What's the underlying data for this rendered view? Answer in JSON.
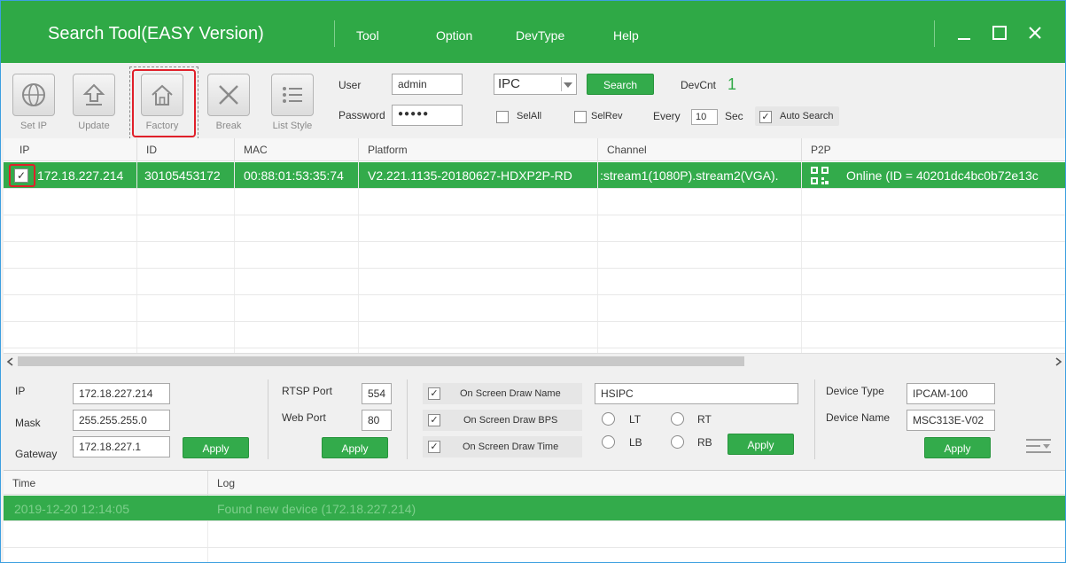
{
  "app": {
    "title": "Search Tool(EASY Version)",
    "menu": [
      "Tool",
      "Option",
      "DevType",
      "Help"
    ]
  },
  "toolbar": {
    "buttons": [
      {
        "label": "Set IP",
        "icon": "globe-icon"
      },
      {
        "label": "Update",
        "icon": "upload-arrow-icon"
      },
      {
        "label": "Factory",
        "icon": "home-icon"
      },
      {
        "label": "Break",
        "icon": "close-x-icon"
      },
      {
        "label": "List Style",
        "icon": "list-icon"
      }
    ],
    "user_label": "User",
    "user_value": "admin",
    "password_label": "Password",
    "password_value": "●●●●●",
    "devtype_value": "IPC",
    "search_label": "Search",
    "devcnt_label": "DevCnt",
    "devcnt_value": "1",
    "selall_label": "SelAll",
    "selrev_label": "SelRev",
    "every_label": "Every",
    "every_value": "10",
    "sec_label": "Sec",
    "auto_search_label": "Auto Search"
  },
  "device_table": {
    "columns": [
      "IP",
      "ID",
      "MAC",
      "Platform",
      "Channel",
      "P2P"
    ],
    "rows": [
      {
        "ip": "172.18.227.214",
        "id": "30105453172",
        "mac": "00:88:01:53:35:74",
        "platform": "V2.221.1135-20180627-HDXP2P-RD",
        "channel": ":stream1(1080P).stream2(VGA).",
        "p2p": "Online (ID = 40201dc4bc0b72e13c"
      }
    ]
  },
  "network": {
    "ip_label": "IP",
    "ip_value": "172.18.227.214",
    "mask_label": "Mask",
    "mask_value": "255.255.255.0",
    "gateway_label": "Gateway",
    "gateway_value": "172.18.227.1",
    "apply_label": "Apply"
  },
  "ports": {
    "rtsp_label": "RTSP Port",
    "rtsp_value": "554",
    "web_label": "Web Port",
    "web_value": "80",
    "apply_label": "Apply"
  },
  "osd": {
    "draw_name_label": "On Screen Draw Name",
    "draw_bps_label": "On Screen Draw BPS",
    "draw_time_label": "On Screen Draw Time",
    "name_value": "HSIPC",
    "lt_label": "LT",
    "rt_label": "RT",
    "lb_label": "LB",
    "rb_label": "RB",
    "apply_label": "Apply"
  },
  "device": {
    "type_label": "Device Type",
    "type_value": "IPCAM-100",
    "name_label": "Device Name",
    "name_value": "MSC313E-V02",
    "apply_label": "Apply"
  },
  "log": {
    "columns": [
      "Time",
      "Log"
    ],
    "rows": [
      {
        "time": "2019-12-20 12:14:05",
        "message": "Found new device (172.18.227.214)"
      }
    ]
  }
}
